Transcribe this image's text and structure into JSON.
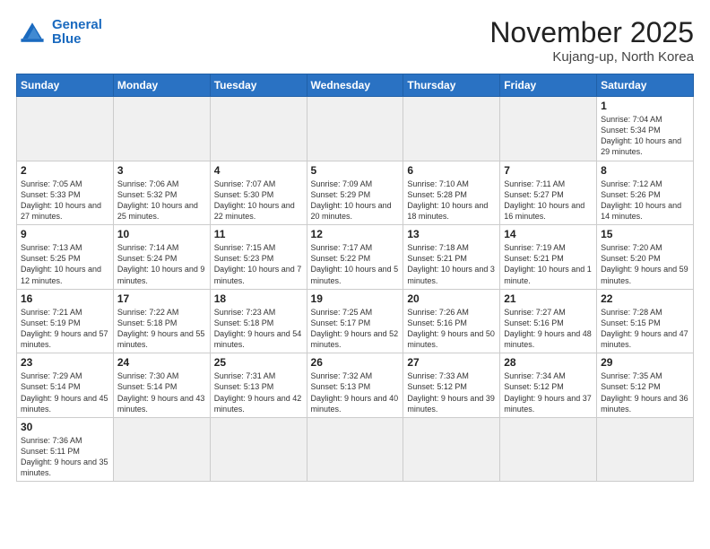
{
  "header": {
    "logo_line1": "General",
    "logo_line2": "Blue",
    "title": "November 2025",
    "subtitle": "Kujang-up, North Korea"
  },
  "calendar": {
    "days_of_week": [
      "Sunday",
      "Monday",
      "Tuesday",
      "Wednesday",
      "Thursday",
      "Friday",
      "Saturday"
    ],
    "weeks": [
      [
        {
          "day": "",
          "info": "",
          "empty": true
        },
        {
          "day": "",
          "info": "",
          "empty": true
        },
        {
          "day": "",
          "info": "",
          "empty": true
        },
        {
          "day": "",
          "info": "",
          "empty": true
        },
        {
          "day": "",
          "info": "",
          "empty": true
        },
        {
          "day": "",
          "info": "",
          "empty": true
        },
        {
          "day": "1",
          "info": "Sunrise: 7:04 AM\nSunset: 5:34 PM\nDaylight: 10 hours\nand 29 minutes."
        }
      ],
      [
        {
          "day": "2",
          "info": "Sunrise: 7:05 AM\nSunset: 5:33 PM\nDaylight: 10 hours\nand 27 minutes."
        },
        {
          "day": "3",
          "info": "Sunrise: 7:06 AM\nSunset: 5:32 PM\nDaylight: 10 hours\nand 25 minutes."
        },
        {
          "day": "4",
          "info": "Sunrise: 7:07 AM\nSunset: 5:30 PM\nDaylight: 10 hours\nand 22 minutes."
        },
        {
          "day": "5",
          "info": "Sunrise: 7:09 AM\nSunset: 5:29 PM\nDaylight: 10 hours\nand 20 minutes."
        },
        {
          "day": "6",
          "info": "Sunrise: 7:10 AM\nSunset: 5:28 PM\nDaylight: 10 hours\nand 18 minutes."
        },
        {
          "day": "7",
          "info": "Sunrise: 7:11 AM\nSunset: 5:27 PM\nDaylight: 10 hours\nand 16 minutes."
        },
        {
          "day": "8",
          "info": "Sunrise: 7:12 AM\nSunset: 5:26 PM\nDaylight: 10 hours\nand 14 minutes."
        }
      ],
      [
        {
          "day": "9",
          "info": "Sunrise: 7:13 AM\nSunset: 5:25 PM\nDaylight: 10 hours\nand 12 minutes."
        },
        {
          "day": "10",
          "info": "Sunrise: 7:14 AM\nSunset: 5:24 PM\nDaylight: 10 hours\nand 9 minutes."
        },
        {
          "day": "11",
          "info": "Sunrise: 7:15 AM\nSunset: 5:23 PM\nDaylight: 10 hours\nand 7 minutes."
        },
        {
          "day": "12",
          "info": "Sunrise: 7:17 AM\nSunset: 5:22 PM\nDaylight: 10 hours\nand 5 minutes."
        },
        {
          "day": "13",
          "info": "Sunrise: 7:18 AM\nSunset: 5:21 PM\nDaylight: 10 hours\nand 3 minutes."
        },
        {
          "day": "14",
          "info": "Sunrise: 7:19 AM\nSunset: 5:21 PM\nDaylight: 10 hours\nand 1 minute."
        },
        {
          "day": "15",
          "info": "Sunrise: 7:20 AM\nSunset: 5:20 PM\nDaylight: 9 hours\nand 59 minutes."
        }
      ],
      [
        {
          "day": "16",
          "info": "Sunrise: 7:21 AM\nSunset: 5:19 PM\nDaylight: 9 hours\nand 57 minutes."
        },
        {
          "day": "17",
          "info": "Sunrise: 7:22 AM\nSunset: 5:18 PM\nDaylight: 9 hours\nand 55 minutes."
        },
        {
          "day": "18",
          "info": "Sunrise: 7:23 AM\nSunset: 5:18 PM\nDaylight: 9 hours\nand 54 minutes."
        },
        {
          "day": "19",
          "info": "Sunrise: 7:25 AM\nSunset: 5:17 PM\nDaylight: 9 hours\nand 52 minutes."
        },
        {
          "day": "20",
          "info": "Sunrise: 7:26 AM\nSunset: 5:16 PM\nDaylight: 9 hours\nand 50 minutes."
        },
        {
          "day": "21",
          "info": "Sunrise: 7:27 AM\nSunset: 5:16 PM\nDaylight: 9 hours\nand 48 minutes."
        },
        {
          "day": "22",
          "info": "Sunrise: 7:28 AM\nSunset: 5:15 PM\nDaylight: 9 hours\nand 47 minutes."
        }
      ],
      [
        {
          "day": "23",
          "info": "Sunrise: 7:29 AM\nSunset: 5:14 PM\nDaylight: 9 hours\nand 45 minutes."
        },
        {
          "day": "24",
          "info": "Sunrise: 7:30 AM\nSunset: 5:14 PM\nDaylight: 9 hours\nand 43 minutes."
        },
        {
          "day": "25",
          "info": "Sunrise: 7:31 AM\nSunset: 5:13 PM\nDaylight: 9 hours\nand 42 minutes."
        },
        {
          "day": "26",
          "info": "Sunrise: 7:32 AM\nSunset: 5:13 PM\nDaylight: 9 hours\nand 40 minutes."
        },
        {
          "day": "27",
          "info": "Sunrise: 7:33 AM\nSunset: 5:12 PM\nDaylight: 9 hours\nand 39 minutes."
        },
        {
          "day": "28",
          "info": "Sunrise: 7:34 AM\nSunset: 5:12 PM\nDaylight: 9 hours\nand 37 minutes."
        },
        {
          "day": "29",
          "info": "Sunrise: 7:35 AM\nSunset: 5:12 PM\nDaylight: 9 hours\nand 36 minutes."
        }
      ],
      [
        {
          "day": "30",
          "info": "Sunrise: 7:36 AM\nSunset: 5:11 PM\nDaylight: 9 hours\nand 35 minutes."
        },
        {
          "day": "",
          "info": "",
          "empty": true
        },
        {
          "day": "",
          "info": "",
          "empty": true
        },
        {
          "day": "",
          "info": "",
          "empty": true
        },
        {
          "day": "",
          "info": "",
          "empty": true
        },
        {
          "day": "",
          "info": "",
          "empty": true
        },
        {
          "day": "",
          "info": "",
          "empty": true
        }
      ]
    ]
  }
}
